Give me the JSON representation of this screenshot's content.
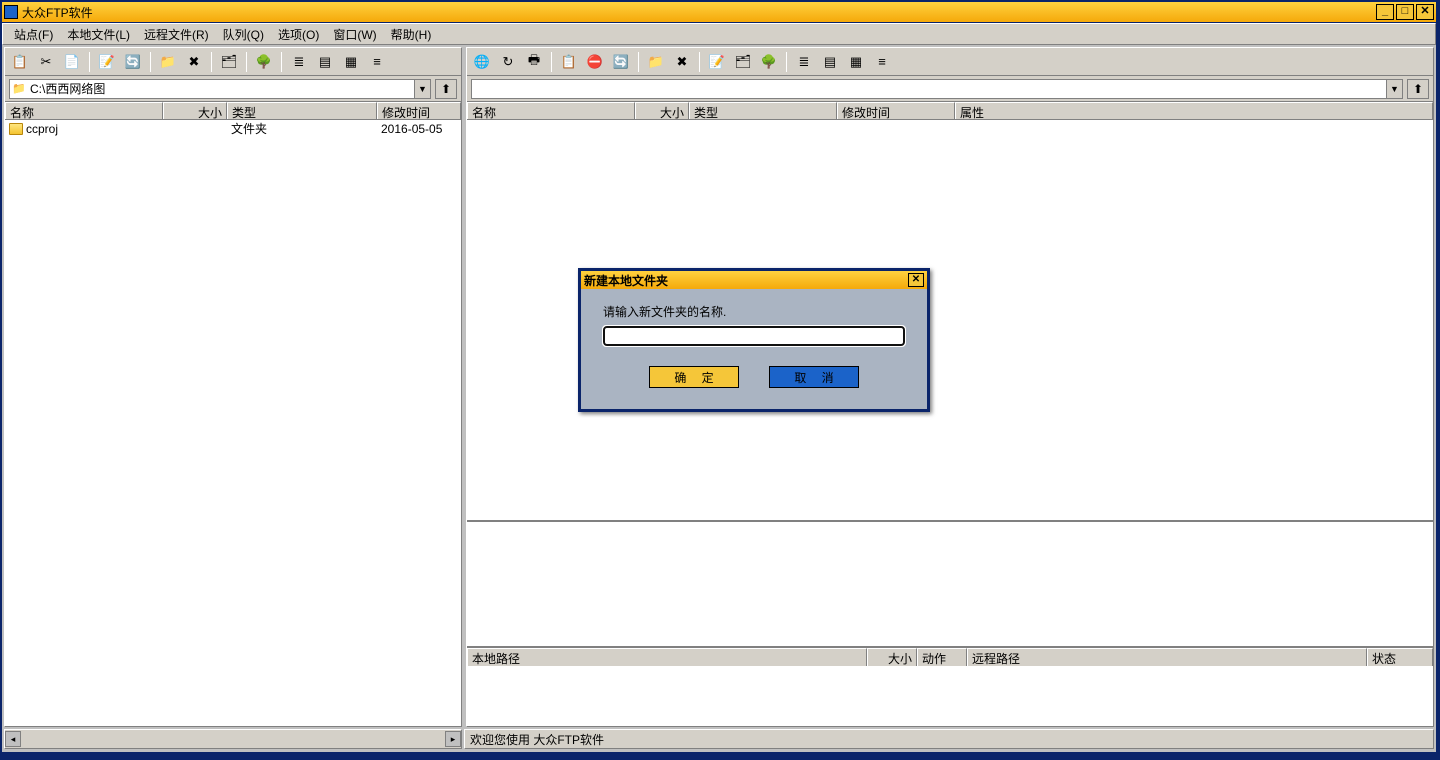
{
  "app": {
    "title": "大众FTP软件"
  },
  "menu": {
    "site": "站点(F)",
    "local": "本地文件(L)",
    "remote": "远程文件(R)",
    "queue": "队列(Q)",
    "options": "选项(O)",
    "window": "窗口(W)",
    "help": "帮助(H)"
  },
  "left": {
    "path": "C:\\西西网络图",
    "columns": {
      "name": "名称",
      "size": "大小",
      "type": "类型",
      "modified": "修改时间"
    },
    "rows": [
      {
        "name": "ccproj",
        "size": "",
        "type": "文件夹",
        "modified": "2016-05-05"
      }
    ]
  },
  "right": {
    "path": "",
    "columns": {
      "name": "名称",
      "size": "大小",
      "type": "类型",
      "modified": "修改时间",
      "attrs": "属性"
    }
  },
  "queue": {
    "columns": {
      "localPath": "本地路径",
      "size": "大小",
      "action": "动作",
      "remotePath": "远程路径",
      "status": "状态"
    }
  },
  "status": {
    "welcome": "欢迎您使用 大众FTP软件"
  },
  "dialog": {
    "title": "新建本地文件夹",
    "label": "请输入新文件夹的名称.",
    "value": "",
    "ok": "确 定",
    "cancel": "取 消"
  },
  "icons": {
    "copy": "📋",
    "cut": "✂",
    "paste": "📄",
    "rename": "📝",
    "refresh": "🔄",
    "newfolder": "📁",
    "delete": "✖",
    "props": "🗂",
    "tree": "🌳",
    "list1": "≣",
    "list2": "▤",
    "list3": "▦",
    "list4": "≡",
    "globe": "🌐",
    "reconnect": "↻",
    "print": "🖶",
    "stop": "⛔",
    "up": "⬆"
  }
}
